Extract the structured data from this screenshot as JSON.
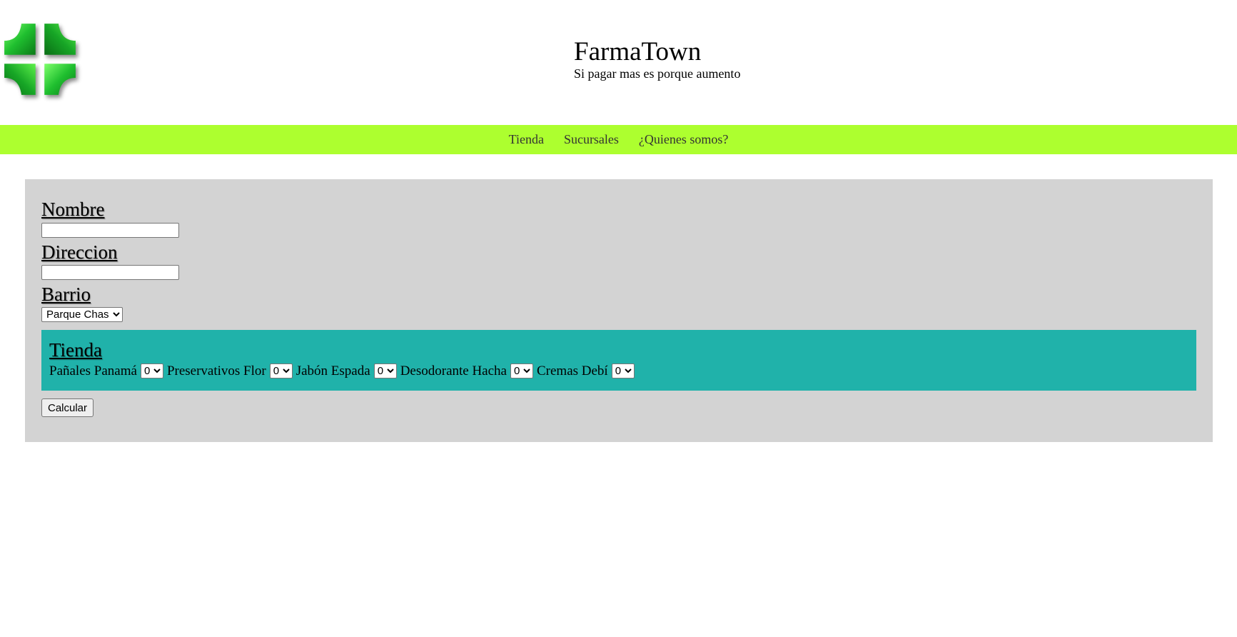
{
  "header": {
    "title": "FarmaTown",
    "subtitle": "Si pagar mas es porque aumento",
    "logo_icon": "pharmacy-cross-icon",
    "logo_color": "#1fbf2f"
  },
  "nav": {
    "background": "#adff2f",
    "items": [
      {
        "label": "Tienda"
      },
      {
        "label": "Sucursales"
      },
      {
        "label": "¿Quienes somos?"
      }
    ]
  },
  "form": {
    "background": "#d3d3d3",
    "nombre_label": "Nombre",
    "nombre_value": "",
    "direccion_label": "Direccion",
    "direccion_value": "",
    "barrio_label": "Barrio",
    "barrio_selected": "Parque Chas",
    "tienda": {
      "background": "#20b2aa",
      "title": "Tienda",
      "products": [
        {
          "name": "Pañales Panamá",
          "qty": "0"
        },
        {
          "name": "Preservativos Flor",
          "qty": "0"
        },
        {
          "name": "Jabón Espada",
          "qty": "0"
        },
        {
          "name": "Desodorante Hacha",
          "qty": "0"
        },
        {
          "name": "Cremas Debí",
          "qty": "0"
        }
      ]
    },
    "submit_label": "Calcular"
  }
}
